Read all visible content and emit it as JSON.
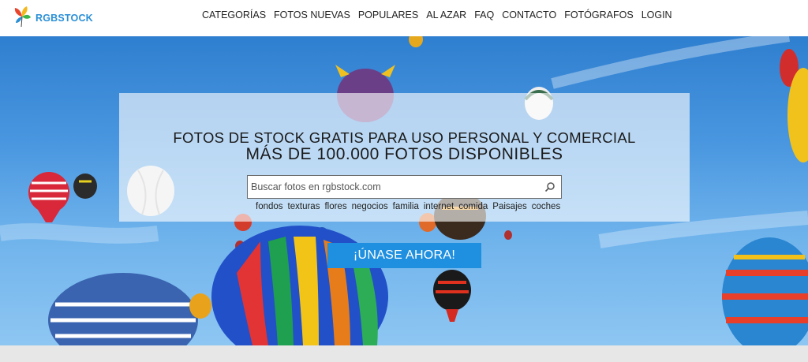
{
  "brand": {
    "name": "RGBSTOCK",
    "logo_icon": "leaf-logo-icon"
  },
  "nav": {
    "items": [
      {
        "label": "CATEGORÍAS"
      },
      {
        "label": "FOTOS NUEVAS"
      },
      {
        "label": "POPULARES"
      },
      {
        "label": "AL AZAR"
      },
      {
        "label": "FAQ"
      },
      {
        "label": "CONTACTO"
      },
      {
        "label": "FOTÓGRAFOS"
      },
      {
        "label": "LOGIN"
      }
    ]
  },
  "hero": {
    "headline": "FOTOS DE STOCK GRATIS PARA USO PERSONAL Y COMERCIAL",
    "subheadline": "MÁS DE 100.000 FOTOS DISPONIBLES",
    "search": {
      "placeholder": "Buscar fotos en rgbstock.com",
      "value": "",
      "icon": "search-icon"
    },
    "tags": [
      {
        "label": "fondos"
      },
      {
        "label": "texturas"
      },
      {
        "label": "flores"
      },
      {
        "label": "negocios"
      },
      {
        "label": "familia"
      },
      {
        "label": "internet"
      },
      {
        "label": "comida"
      },
      {
        "label": "Paisajes"
      },
      {
        "label": "coches"
      }
    ],
    "cta_label": "¡ÚNASE AHORA!"
  },
  "colors": {
    "brand_blue": "#2a8fd6",
    "cta_blue": "#1f8fe0",
    "sky": "#4a97e0"
  }
}
